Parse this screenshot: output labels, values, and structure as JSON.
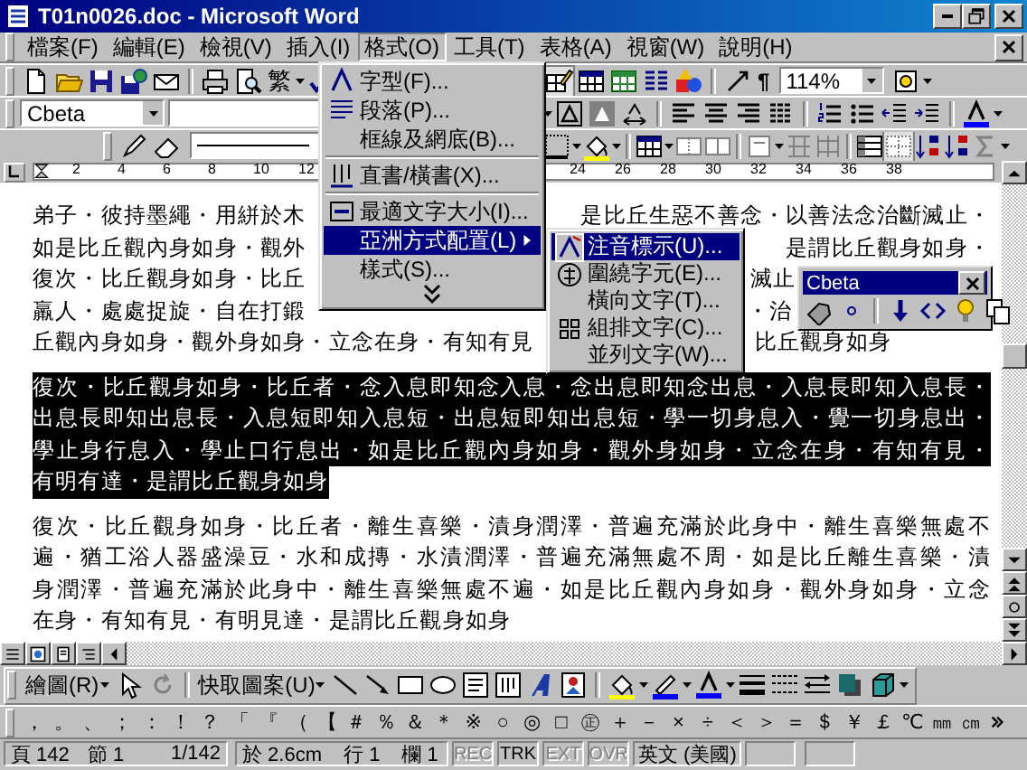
{
  "window": {
    "title": "T01n0026.doc - Microsoft Word"
  },
  "menu_bar": [
    {
      "label": "檔案(F)",
      "selected": false
    },
    {
      "label": "編輯(E)",
      "selected": false
    },
    {
      "label": "檢視(V)",
      "selected": false
    },
    {
      "label": "插入(I)",
      "selected": false
    },
    {
      "label": "格式(O)",
      "selected": true
    },
    {
      "label": "工具(T)",
      "selected": false
    },
    {
      "label": "表格(A)",
      "selected": false
    },
    {
      "label": "視窗(W)",
      "selected": false
    },
    {
      "label": "說明(H)",
      "selected": false
    }
  ],
  "toolbar": {
    "convert": "繁",
    "show_marks": "¶",
    "zoom": "114%",
    "style": "Cbeta"
  },
  "ruler": {
    "left_labels": [
      "2",
      "4",
      "6",
      "8",
      "10",
      "12"
    ],
    "right_labels": [
      "24",
      "26",
      "28",
      "30",
      "32",
      "34",
      "36",
      "38"
    ]
  },
  "format_menu": [
    {
      "kind": "item",
      "label": "字型(F)...",
      "selected": false
    },
    {
      "kind": "item",
      "label": "段落(P)...",
      "selected": false
    },
    {
      "kind": "item",
      "label": "框線及網底(B)...",
      "selected": false
    },
    {
      "kind": "separator"
    },
    {
      "kind": "item",
      "label": "直書/橫書(X)...",
      "selected": false
    },
    {
      "kind": "separator"
    },
    {
      "kind": "item",
      "label": "最適文字大小(I)...",
      "selected": false
    },
    {
      "kind": "submenu",
      "label": "亞洲方式配置(L)",
      "selected": true
    },
    {
      "kind": "item",
      "label": "樣式(S)...",
      "selected": false
    },
    {
      "kind": "expand"
    }
  ],
  "asian_layout_menu": [
    {
      "label": "注音標示(U)...",
      "selected": true
    },
    {
      "label": "圍繞字元(E)...",
      "selected": false
    },
    {
      "label": "橫向文字(T)...",
      "selected": false
    },
    {
      "label": "組排文字(C)...",
      "selected": false
    },
    {
      "label": "並列文字(W)...",
      "selected": false
    }
  ],
  "document": {
    "paragraphs": [
      {
        "kind": "partial",
        "selected": false,
        "lines": [
          [
            "弟子・彼持墨繩・用絣於木",
            "是比丘生惡不善念・以善法念治斷滅止・"
          ],
          [
            "如是比丘觀內身如身・觀外",
            "是謂比丘觀身如身・"
          ],
          [
            "復次・比丘觀身如身・比丘",
            "滅止"
          ],
          [
            "羸人・處處捉旋・自在打鍛",
            "・治"
          ],
          [
            "丘觀內身如身・觀外身如身・立念在身・有知有見",
            "比丘觀身如身"
          ]
        ]
      },
      {
        "kind": "full",
        "selected": true,
        "lines": [
          "復次・比丘觀身如身・比丘者・念入息即知念入息・念出息即知念出息・入息長即知入息長・",
          "出息長即知出息長・入息短即知入息短・出息短即知出息短・學一切身息入・覺一切身息出・",
          "學止身行息入・學止口行息出・如是比丘觀內身如身・觀外身如身・立念在身・有知有見・",
          "有明有達・是謂比丘觀身如身"
        ]
      },
      {
        "kind": "full",
        "selected": false,
        "lines": [
          "復次・比丘觀身如身・比丘者・離生喜樂・漬身潤澤・普遍充滿於此身中・離生喜樂無處不",
          "遍・猶工浴人器盛澡豆・水和成摶・水漬潤澤・普遍充滿無處不周・如是比丘離生喜樂・漬",
          "身潤澤・普遍充滿於此身中・離生喜樂無處不遍・如是比丘觀內身如身・觀外身如身・立念",
          "在身・有知有見・有明見達・是謂比丘觀身如身"
        ]
      }
    ]
  },
  "floating_toolbar": {
    "title": "Cbeta"
  },
  "drawing_toolbar": {
    "draw": "繪圖(R)",
    "autoshapes": "快取圖案(U)"
  },
  "symbol_toolbar": [
    "，",
    "。",
    "、",
    "；",
    "：",
    "！",
    "？",
    "「",
    "『",
    "（",
    "【",
    "＃",
    "％",
    "＆",
    "＊",
    "※",
    "○",
    "◎",
    "□",
    "㊣",
    "＋",
    "－",
    "×",
    "÷",
    "＜",
    "＞",
    "＝",
    "＄",
    "￥",
    "￡",
    "℃",
    "㎜",
    "㎝"
  ],
  "status_bar": {
    "page": "頁 142",
    "section": "節 1",
    "pages": "1/142",
    "position": "於 2.6cm",
    "line": "行 1",
    "column": "欄 1",
    "modes": [
      {
        "label": "REC",
        "on": false
      },
      {
        "label": "TRK",
        "on": true
      },
      {
        "label": "EXT",
        "on": false
      },
      {
        "label": "OVR",
        "on": false
      }
    ],
    "language": "英文 (美國)"
  }
}
